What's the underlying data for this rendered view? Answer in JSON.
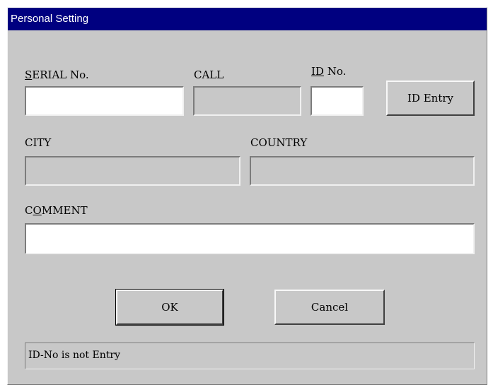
{
  "window": {
    "title": "Personal Setting"
  },
  "form": {
    "serial": {
      "label_u": "S",
      "label_rest": "ERIAL No.",
      "value": ""
    },
    "call": {
      "label": "CALL",
      "value": ""
    },
    "id": {
      "label_u": "ID",
      "label_rest": " No.",
      "value": ""
    },
    "id_entry_label": "ID Entry",
    "city": {
      "label": "CITY",
      "value": ""
    },
    "country": {
      "label": "COUNTRY",
      "value": ""
    },
    "comment": {
      "label_pre": "C",
      "label_u": "O",
      "label_rest": "MMENT",
      "value": ""
    }
  },
  "buttons": {
    "ok": "OK",
    "cancel": "Cancel"
  },
  "status": {
    "text": "ID-No is not Entry"
  },
  "colors": {
    "titlebar": "#000080",
    "dialog": "#c8c8c8",
    "input": "#ffffff"
  }
}
